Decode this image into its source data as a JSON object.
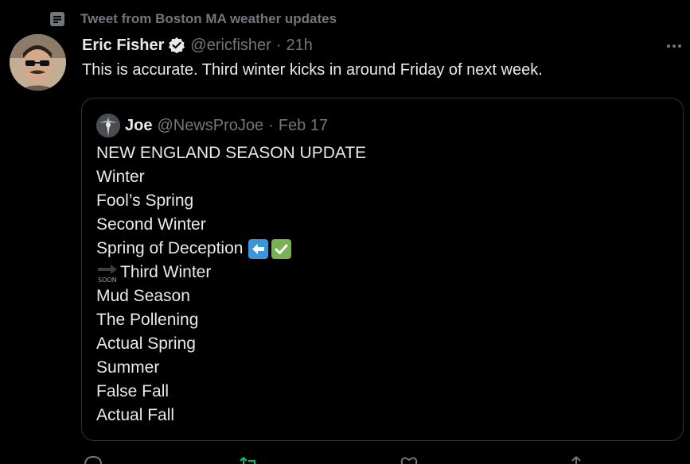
{
  "social_context": {
    "text": "Tweet from Boston MA weather updates",
    "icon": "list-icon"
  },
  "tweet": {
    "author_name": "Eric Fisher",
    "handle": "@ericfisher",
    "separator": "·",
    "time": "21h",
    "verified": true,
    "text": "This is accurate. Third winter kicks in around Friday of next week."
  },
  "quote": {
    "author_name": "Joe",
    "handle": "@NewsProJoe",
    "separator": "·",
    "date": "Feb 17",
    "lines": [
      "NEW ENGLAND SEASON UPDATE",
      "Winter",
      "Fool’s Spring",
      "Second Winter",
      "Spring of Deception",
      "Third Winter",
      "Mud Season",
      "The Pollening",
      "Actual Spring",
      "Summer",
      "False Fall",
      "Actual Fall"
    ],
    "soon_label": "SOON"
  },
  "actions": [
    "reply-icon",
    "retweet-icon",
    "like-icon",
    "share-icon"
  ],
  "colors": {
    "background": "#000000",
    "text": "#e7e9ea",
    "muted": "#71767b",
    "border": "#2f3336",
    "retweet_accent": "#00ba7c"
  }
}
